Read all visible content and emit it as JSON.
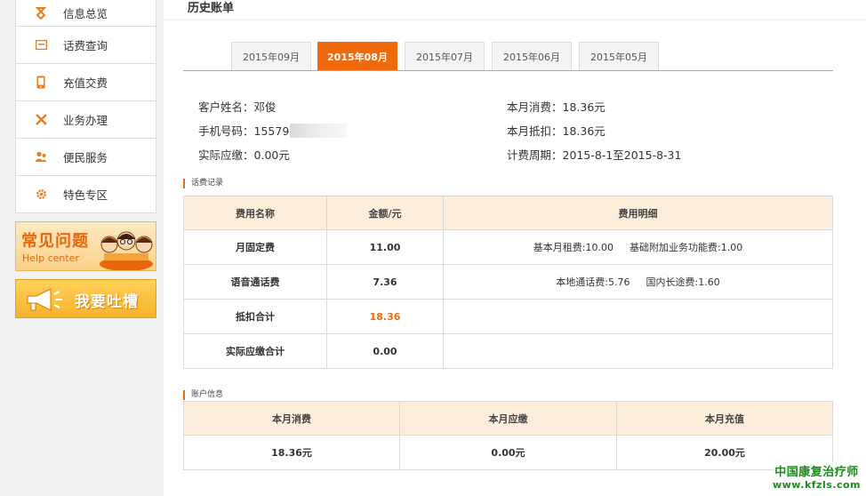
{
  "sidebar": {
    "items": [
      {
        "label": "信息总览",
        "icon": "ribbon-icon"
      },
      {
        "label": "话费查询",
        "icon": "bill-icon"
      },
      {
        "label": "充值交费",
        "icon": "phone-icon"
      },
      {
        "label": "业务办理",
        "icon": "tools-icon"
      },
      {
        "label": "便民服务",
        "icon": "people-icon"
      },
      {
        "label": "特色专区",
        "icon": "gear-icon"
      }
    ],
    "faq_banner": {
      "title": "常见问题",
      "subtitle": "Help center"
    },
    "complain_banner": {
      "title": "我要吐槽"
    }
  },
  "page": {
    "title": "历史账单"
  },
  "tabs": [
    {
      "label": "2015年09月",
      "active": false
    },
    {
      "label": "2015年08月",
      "active": true
    },
    {
      "label": "2015年07月",
      "active": false
    },
    {
      "label": "2015年06月",
      "active": false
    },
    {
      "label": "2015年05月",
      "active": false
    }
  ],
  "customer": {
    "name_label": "客户姓名：",
    "name_value": "邓俊",
    "phone_label": "手机号码：",
    "phone_value": "15579",
    "due_label": "实际应缴：",
    "due_value": "0.00元",
    "consume_label": "本月消费：",
    "consume_value": "18.36元",
    "deduct_label": "本月抵扣：",
    "deduct_value": "18.36元",
    "period_label": "计费周期：",
    "period_value": "2015-8-1至2015-8-31"
  },
  "fee_records": {
    "section_title": "话费记录",
    "headers": [
      "费用名称",
      "金额/元",
      "费用明细"
    ],
    "rows": [
      {
        "name": "月固定费",
        "amount": "11.00",
        "details": [
          "基本月租费:10.00",
          "基础附加业务功能费:1.00"
        ]
      },
      {
        "name": "语音通话费",
        "amount": "7.36",
        "details": [
          "本地通话费:5.76",
          "国内长途费:1.60"
        ]
      },
      {
        "name": "抵扣合计",
        "amount": "18.36",
        "details": []
      },
      {
        "name": "实际应缴合计",
        "amount": "0.00",
        "details": []
      }
    ]
  },
  "account": {
    "section_title": "账户信息",
    "headers": [
      "本月消费",
      "本月应缴",
      "本月充值"
    ],
    "values": [
      "18.36元",
      "0.00元",
      "20.00元"
    ]
  },
  "watermark": {
    "line1": "中国康复治疗师",
    "line2": "www.kfzls.com"
  },
  "colors": {
    "accent": "#f06a0c",
    "header_bg": "#fdeedb",
    "watermark": "#1a8a1a"
  }
}
